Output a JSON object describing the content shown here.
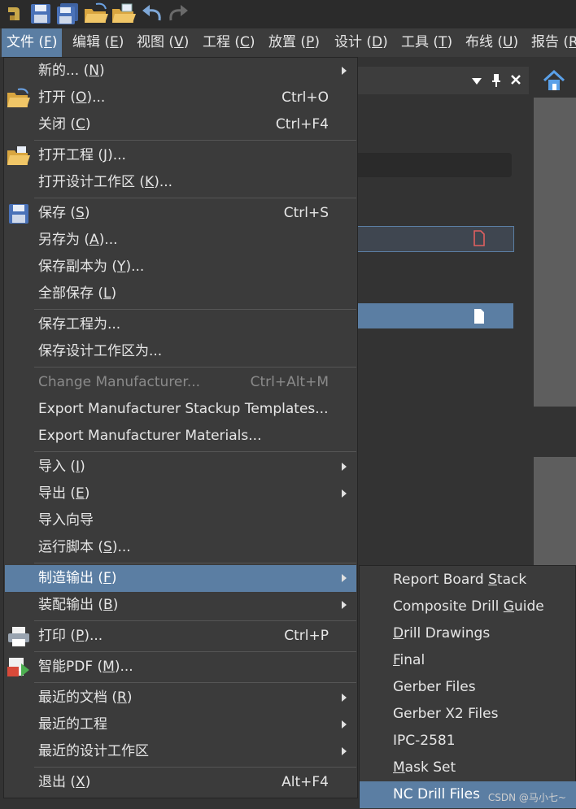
{
  "toolbar": {
    "icons": [
      "app-logo-icon",
      "save-icon",
      "save-all-icon",
      "open-folder-icon",
      "open-project-icon",
      "undo-icon",
      "redo-icon"
    ]
  },
  "menubar": [
    {
      "label": "文件 (",
      "key": "F",
      "tail": ")"
    },
    {
      "label": "编辑 (",
      "key": "E",
      "tail": ")"
    },
    {
      "label": "视图 (",
      "key": "V",
      "tail": ")"
    },
    {
      "label": "工程 (",
      "key": "C",
      "tail": ")"
    },
    {
      "label": "放置 (",
      "key": "P",
      "tail": ")"
    },
    {
      "label": "设计 (",
      "key": "D",
      "tail": ")"
    },
    {
      "label": "工具 (",
      "key": "T",
      "tail": ")"
    },
    {
      "label": "布线 (",
      "key": "U",
      "tail": ")"
    },
    {
      "label": "报告 (",
      "key": "R",
      "tail": ""
    }
  ],
  "file_menu": [
    {
      "pre": "新的... (",
      "key": "N",
      "post": ")",
      "shortcut": "",
      "submenu": true
    },
    {
      "pre": "打开 (",
      "key": "O",
      "post": ")...",
      "shortcut": "Ctrl+O",
      "icon": "open-folder-icon"
    },
    {
      "pre": "关闭 (",
      "key": "C",
      "post": ")",
      "shortcut": "Ctrl+F4"
    },
    {
      "pre": "打开工程 (",
      "key": "J",
      "post": ")...",
      "shortcut": "",
      "icon": "open-project-icon"
    },
    {
      "pre": "打开设计工作区 (",
      "key": "K",
      "post": ")...",
      "shortcut": ""
    },
    {
      "pre": "保存 (",
      "key": "S",
      "post": ")",
      "shortcut": "Ctrl+S",
      "icon": "save-icon"
    },
    {
      "pre": "另存为 (",
      "key": "A",
      "post": ")...",
      "shortcut": ""
    },
    {
      "pre": "保存副本为 (",
      "key": "Y",
      "post": ")...",
      "shortcut": ""
    },
    {
      "pre": "全部保存 (",
      "key": "L",
      "post": ")",
      "shortcut": ""
    },
    {
      "pre": "保存工程为...",
      "key": "",
      "post": "",
      "shortcut": ""
    },
    {
      "pre": "保存设计工作区为...",
      "key": "",
      "post": "",
      "shortcut": ""
    },
    {
      "pre": "Change Manufacturer...",
      "key": "",
      "post": "",
      "shortcut": "Ctrl+Alt+M",
      "disabled": true
    },
    {
      "pre": "Export Manufacturer Stackup Templates...",
      "key": "",
      "post": "",
      "shortcut": ""
    },
    {
      "pre": "Export Manufacturer Materials...",
      "key": "",
      "post": "",
      "shortcut": ""
    },
    {
      "pre": "导入 (",
      "key": "I",
      "post": ")",
      "shortcut": "",
      "submenu": true
    },
    {
      "pre": "导出 (",
      "key": "E",
      "post": ")",
      "shortcut": "",
      "submenu": true
    },
    {
      "pre": "导入向导",
      "key": "",
      "post": "",
      "shortcut": ""
    },
    {
      "pre": "运行脚本 (",
      "key": "S",
      "post": ")...",
      "shortcut": ""
    },
    {
      "pre": "制造输出 (",
      "key": "F",
      "post": ")",
      "shortcut": "",
      "submenu": true,
      "selected": true
    },
    {
      "pre": "装配输出 (",
      "key": "B",
      "post": ")",
      "shortcut": "",
      "submenu": true
    },
    {
      "pre": "打印 (",
      "key": "P",
      "post": ")...",
      "shortcut": "Ctrl+P",
      "icon": "print-icon"
    },
    {
      "pre": "智能PDF (",
      "key": "M",
      "post": ")...",
      "shortcut": "",
      "icon": "smart-pdf-icon"
    },
    {
      "pre": "最近的文档 (",
      "key": "R",
      "post": ")",
      "shortcut": "",
      "submenu": true
    },
    {
      "pre": "最近的工程",
      "key": "",
      "post": "",
      "shortcut": "",
      "submenu": true
    },
    {
      "pre": "最近的设计工作区",
      "key": "",
      "post": "",
      "shortcut": "",
      "submenu": true
    },
    {
      "pre": "退出 (",
      "key": "X",
      "post": ")",
      "shortcut": "Alt+F4"
    }
  ],
  "fabrication_submenu": [
    {
      "pre": "Report Board ",
      "key": "S",
      "post": "tack"
    },
    {
      "pre": "Composite Drill ",
      "key": "G",
      "post": "uide"
    },
    {
      "pre": "",
      "key": "D",
      "post": "rill Drawings"
    },
    {
      "pre": "",
      "key": "F",
      "post": "inal"
    },
    {
      "pre": "Gerber Files",
      "key": "",
      "post": ""
    },
    {
      "pre": "Gerber X2 Files",
      "key": "",
      "post": ""
    },
    {
      "pre": "IPC-2581",
      "key": "",
      "post": ""
    },
    {
      "pre": "",
      "key": "M",
      "post": "ask Set"
    },
    {
      "pre": "NC Drill Files",
      "key": "",
      "post": "",
      "selected": true
    }
  ],
  "watermark": "CSDN @马小七~",
  "colors": {
    "highlight": "#5b7ea3",
    "menu_bg": "#3b3b3b",
    "text": "#e6e6e6",
    "disabled": "#8a8a8a"
  }
}
